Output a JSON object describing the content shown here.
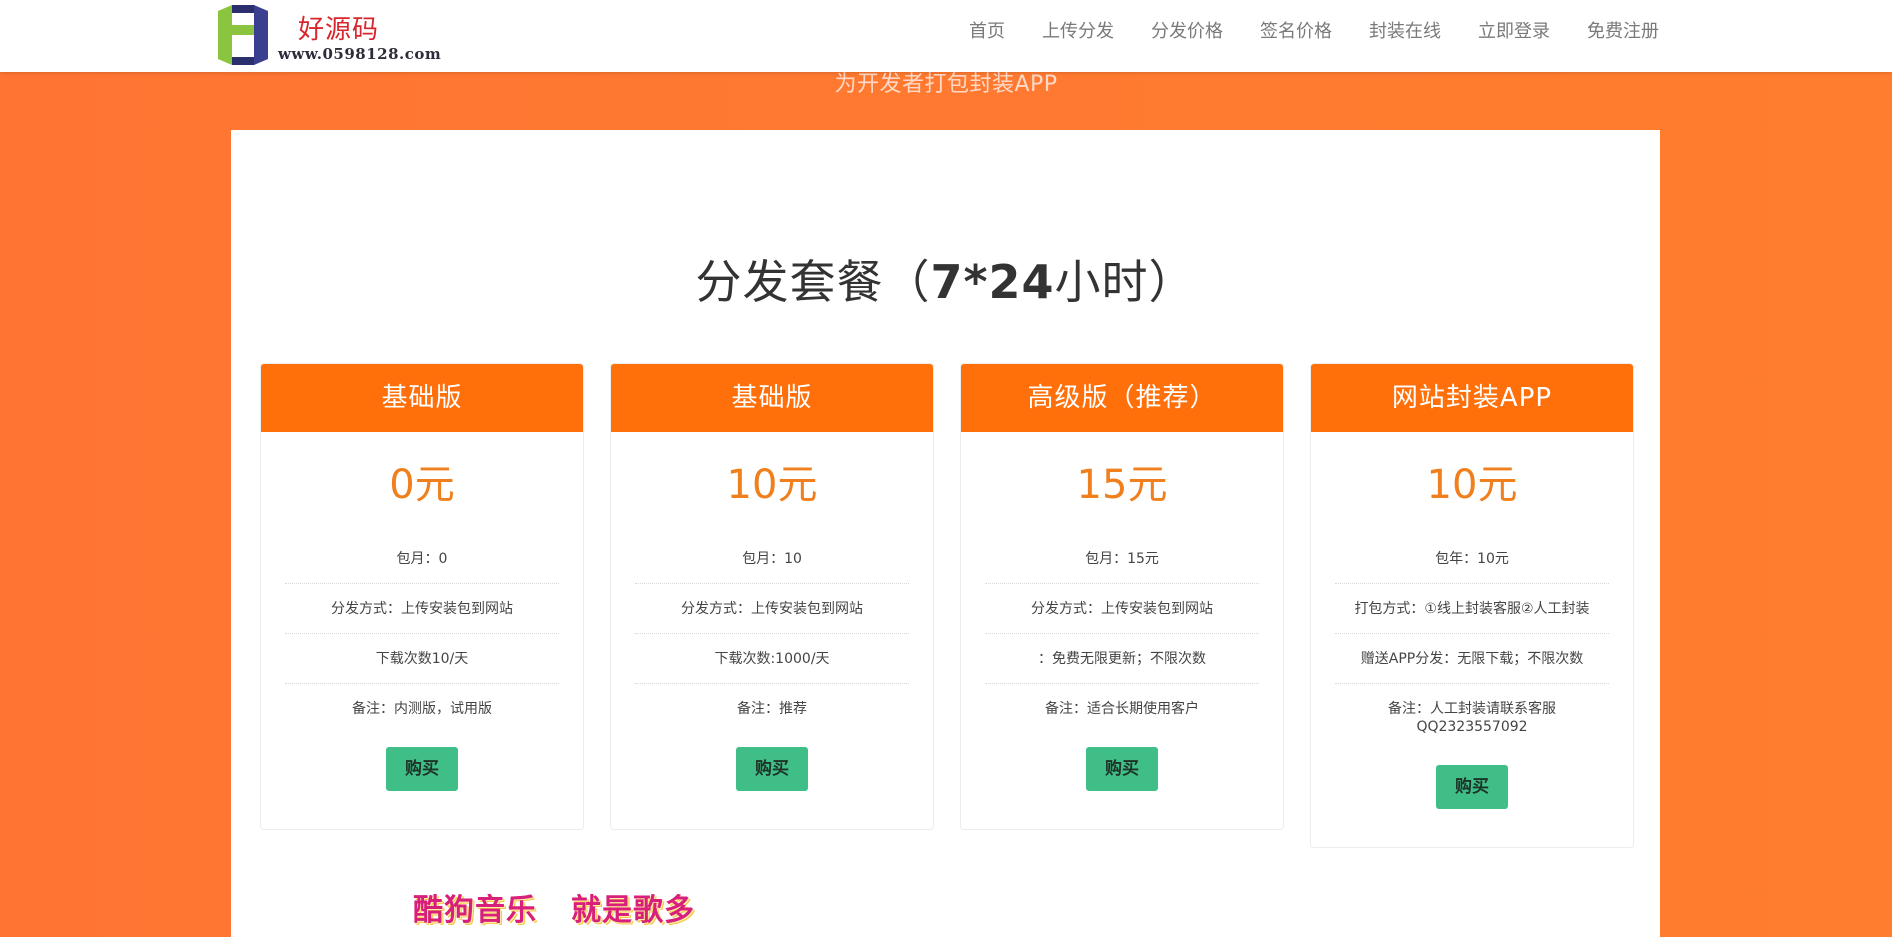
{
  "logo": {
    "text": "好源码",
    "url_text": "www.0598128.com",
    "brand_color": "#d7262d"
  },
  "nav": [
    {
      "label": "首页"
    },
    {
      "label": "上传分发"
    },
    {
      "label": "分发价格"
    },
    {
      "label": "签名价格"
    },
    {
      "label": "封装在线"
    },
    {
      "label": "立即登录"
    },
    {
      "label": "免费注册"
    }
  ],
  "hero": {
    "subtitle": "为开发者打包封装APP"
  },
  "pricing": {
    "title_prefix": "分发套餐（",
    "title_bold": "7*24",
    "title_suffix": "小时）",
    "accent_color": "#ff6f0a",
    "price_color": "#f0801e",
    "button_color": "#3fbf87",
    "plans": [
      {
        "name": "基础版",
        "price": "0元",
        "rows": [
          "包月：0",
          "分发方式：上传安装包到网站",
          "下载次数10/天",
          "备注：内测版，试用版"
        ],
        "buy_label": "购买"
      },
      {
        "name": "基础版",
        "price": "10元",
        "rows": [
          "包月：10",
          "分发方式：上传安装包到网站",
          "下载次数:1000/天",
          "备注：推荐"
        ],
        "buy_label": "购买"
      },
      {
        "name": "高级版（推荐）",
        "price": "15元",
        "rows": [
          "包月：15元",
          "分发方式：上传安装包到网站",
          "：免费无限更新；不限次数",
          "备注：适合长期使用客户"
        ],
        "buy_label": "购买"
      },
      {
        "name": "网站封装APP",
        "price": "10元",
        "rows": [
          "包年：10元",
          "打包方式：①线上封装客服②人工封装",
          "赠送APP分发：无限下载；不限次数",
          "备注：人工封装请联系客服QQ2323557092"
        ],
        "buy_label": "购买"
      }
    ]
  },
  "footer_banner": {
    "part1": "酷狗音乐",
    "part2": "就是歌多"
  }
}
